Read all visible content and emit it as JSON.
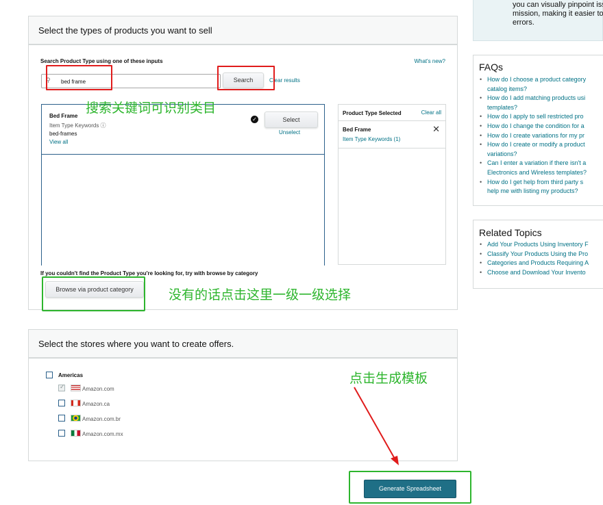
{
  "top_info": {
    "lines": [
      "you can visually pinpoint iss",
      "mission, making it easier to",
      "errors."
    ]
  },
  "product_section": {
    "title": "Select the types of products you want to sell",
    "search_label": "Search Product Type using one of these inputs",
    "whats_new": "What's new?",
    "search_value": "bed frame",
    "search_button": "Search",
    "clear_results": "Clear results",
    "result": {
      "name": "Bed Frame",
      "keywords_label": "Item Type Keywords ⓘ",
      "keyword": "bed-frames",
      "view_all": "View all",
      "select_button": "Select",
      "unselect": "Unselect"
    },
    "selected_panel": {
      "title": "Product Type Selected",
      "clear_all": "Clear all",
      "item_name": "Bed Frame",
      "item_keywords": "Item Type Keywords (1)"
    },
    "browse_hint": "If you couldn't find the Product Type you're looking for, try with browse by category",
    "browse_button": "Browse via product category"
  },
  "stores_section": {
    "title": "Select the stores where you want to create offers.",
    "region": "Americas",
    "stores": [
      {
        "label": "Amazon.com",
        "checked": true
      },
      {
        "label": "Amazon.ca",
        "checked": false
      },
      {
        "label": "Amazon.com.br",
        "checked": false
      },
      {
        "label": "Amazon.com.mx",
        "checked": false
      }
    ]
  },
  "generate_button": "Generate Spreadsheet",
  "annotations": {
    "search_note": "搜索关键词可识别类目",
    "browse_note": "没有的话点击这里一级一级选择",
    "generate_note": "点击生成模板"
  },
  "faqs": {
    "title": "FAQs",
    "items": [
      "How do I choose a product category",
      "catalog items?",
      "How do I add matching products usi",
      "templates?",
      "How do I apply to sell restricted pro",
      "How do I change the condition for a",
      "How do I create variations for my pr",
      "How do I create or modify a product",
      "variations?",
      "Can I enter a variation if there isn't a",
      "Electronics and Wireless templates?",
      "How do I get help from third party s",
      "help me with listing my products?"
    ]
  },
  "related": {
    "title": "Related Topics",
    "items": [
      "Add Your Products Using Inventory F",
      "Classify Your Products Using the Pro",
      "Categories and Products Requiring A",
      "Choose and Download Your Invento"
    ]
  },
  "colors": {
    "annotation_green": "#2db52d",
    "highlight_red": "#e01b1b",
    "primary_teal": "#1f6f86",
    "link": "#007185"
  }
}
